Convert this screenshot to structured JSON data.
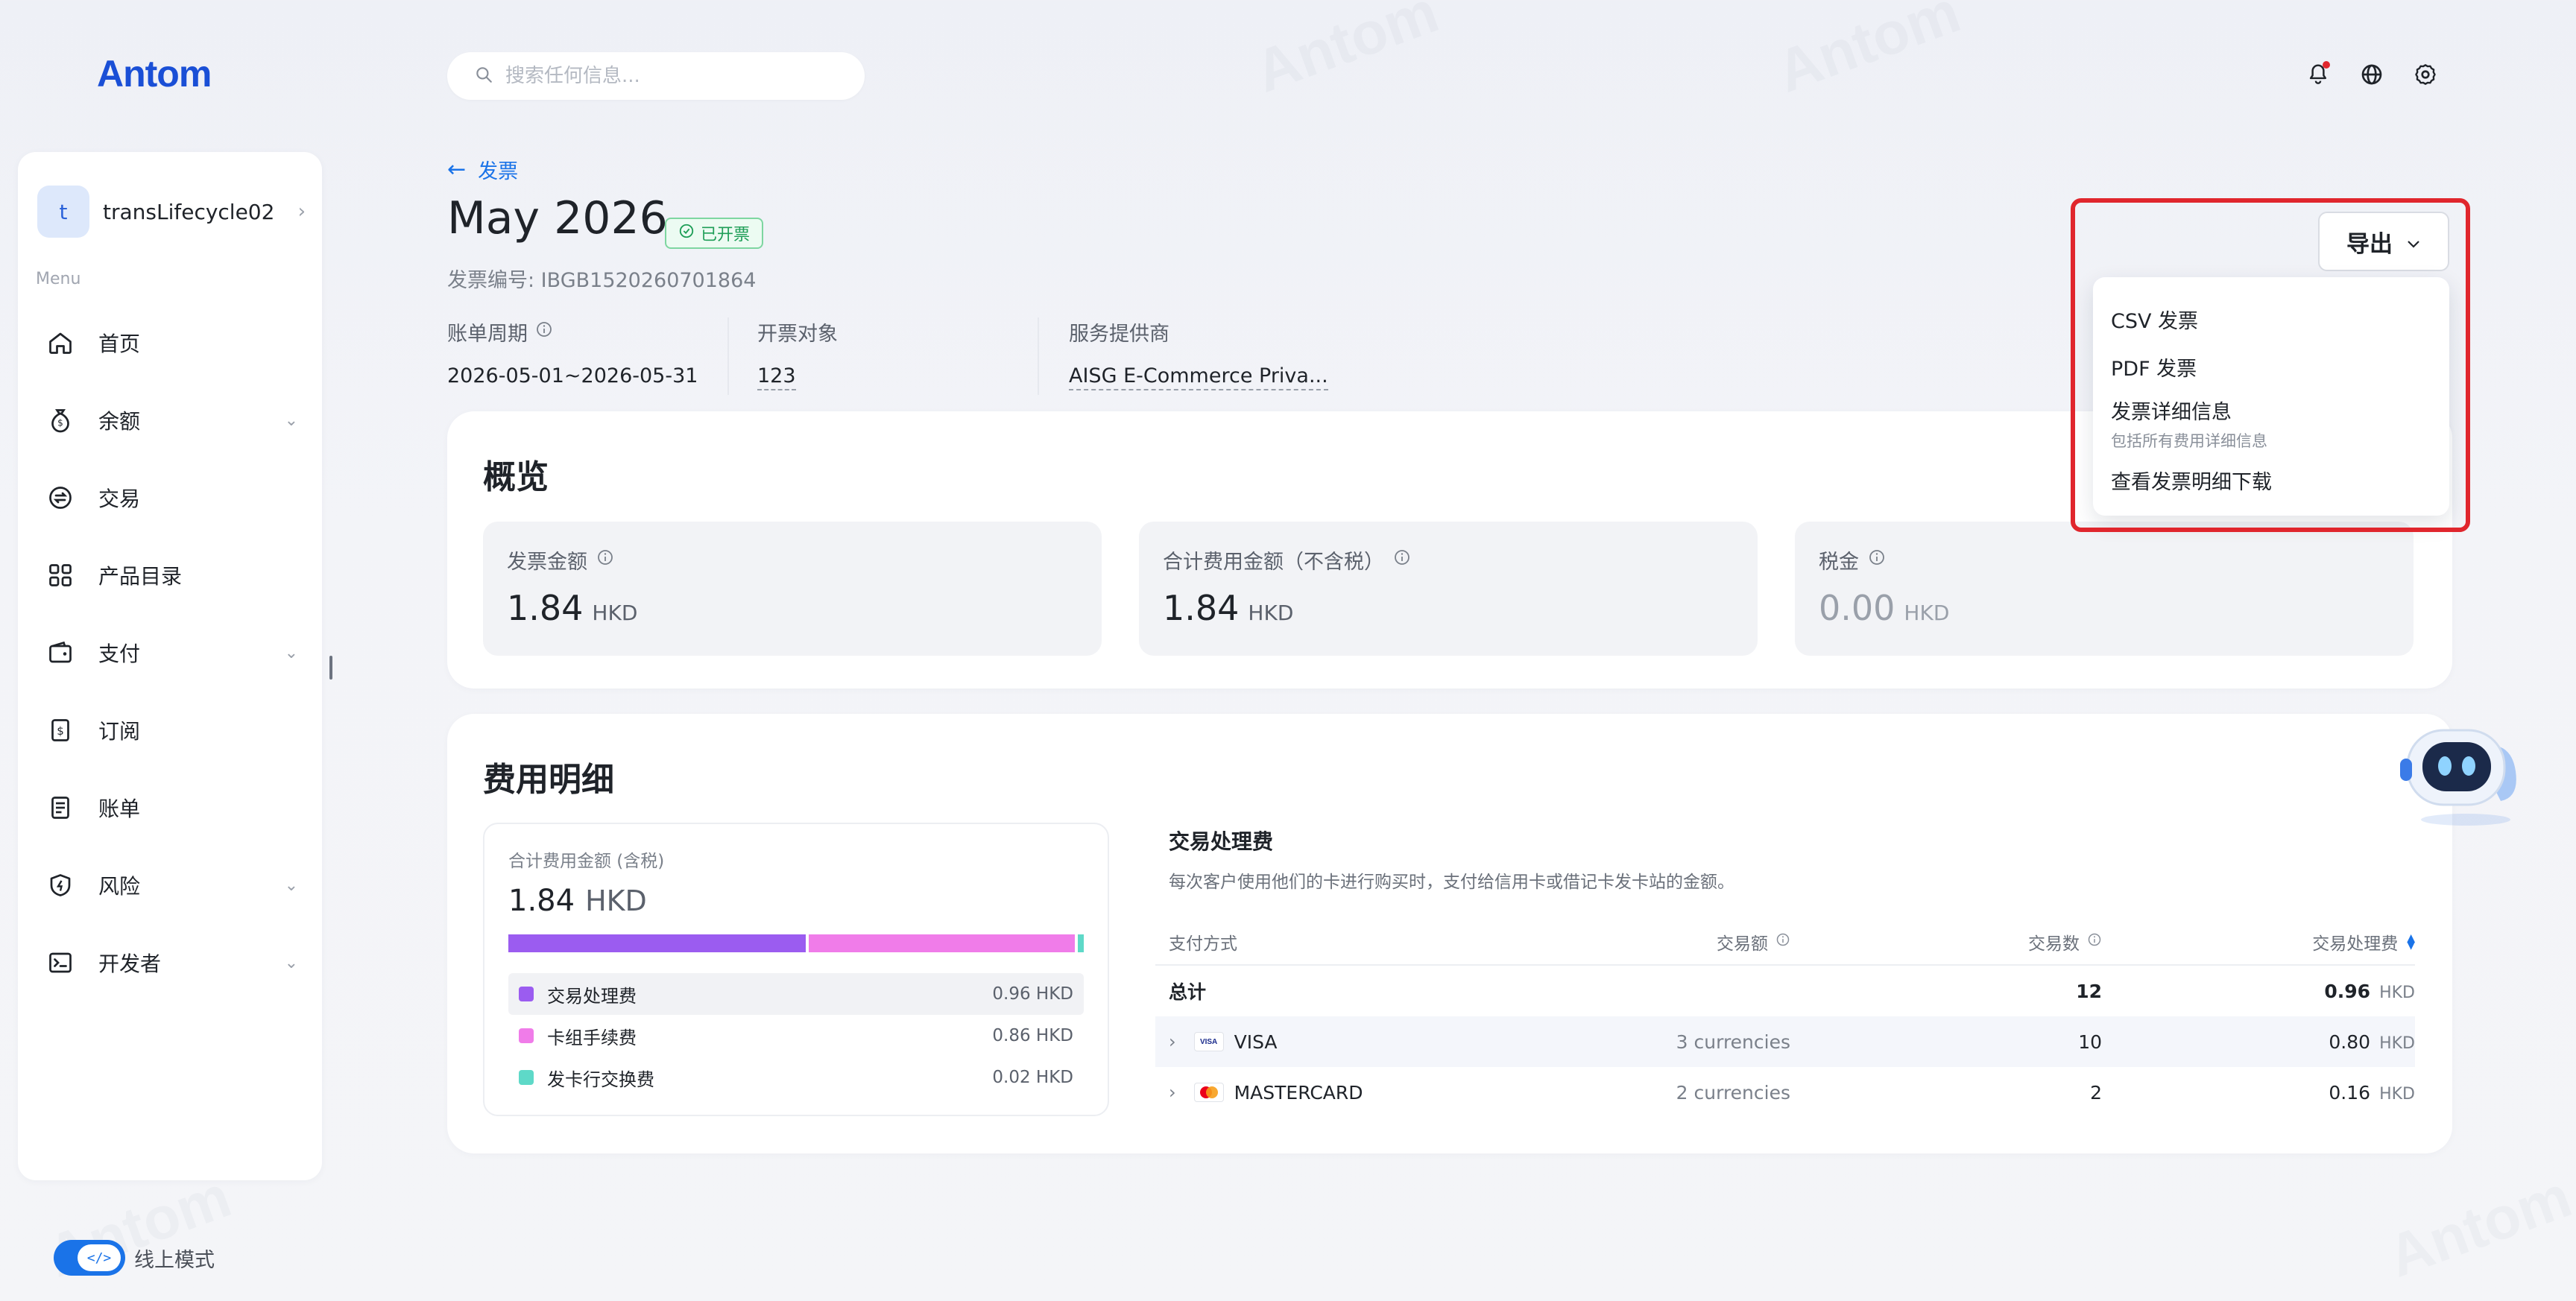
{
  "brand": {
    "logo_text": "Antom",
    "accent": "#1a73e8",
    "watermark": "Antom"
  },
  "search": {
    "placeholder": "搜索任何信息..."
  },
  "sidebar": {
    "account_initial": "t",
    "account_name": "transLifecycle02",
    "menu_label": "Menu",
    "items": [
      {
        "label": "首页",
        "icon": "home-icon",
        "expandable": false
      },
      {
        "label": "余额",
        "icon": "money-bag-icon",
        "expandable": true
      },
      {
        "label": "交易",
        "icon": "exchange-icon",
        "expandable": false
      },
      {
        "label": "产品目录",
        "icon": "grid-icon",
        "expandable": false
      },
      {
        "label": "支付",
        "icon": "wallet-icon",
        "expandable": true
      },
      {
        "label": "订阅",
        "icon": "subscription-icon",
        "expandable": false
      },
      {
        "label": "账单",
        "icon": "bill-icon",
        "expandable": false
      },
      {
        "label": "风险",
        "icon": "shield-icon",
        "expandable": true
      },
      {
        "label": "开发者",
        "icon": "terminal-icon",
        "expandable": true
      }
    ],
    "mode_label": "线上模式",
    "mode_toggle": "</>"
  },
  "header": {
    "back_label": "发票",
    "title": "May 2026",
    "status": "已开票",
    "invoice_no": "发票编号: IBGB1520260701864",
    "meta": [
      {
        "label": "账单周期",
        "value": "2026-05-01~2026-05-31"
      },
      {
        "label": "开票对象",
        "value": "123"
      },
      {
        "label": "服务提供商",
        "value": "AISG E-Commerce Priva..."
      }
    ]
  },
  "export": {
    "button_label": "导出",
    "options": [
      {
        "label": "CSV 发票"
      },
      {
        "label": "PDF 发票"
      },
      {
        "label": "发票详细信息",
        "sub": "包括所有费用详细信息"
      },
      {
        "label": "查看发票明细下载"
      }
    ]
  },
  "overview": {
    "title": "概览",
    "kpis": [
      {
        "label": "发票金额",
        "value": "1.84",
        "currency": "HKD"
      },
      {
        "label": "合计费用金额（不含税）",
        "value": "1.84",
        "currency": "HKD"
      },
      {
        "label": "税金",
        "value": "0.00",
        "currency": "HKD"
      }
    ]
  },
  "fees": {
    "title": "费用明细",
    "total_label": "合计费用金额 (含税)",
    "total_value": "1.84",
    "total_currency": "HKD",
    "breakdown": [
      {
        "label": "交易处理费",
        "value": "0.96 HKD",
        "amount": 0.96,
        "color": "#9b5cf0"
      },
      {
        "label": "卡组手续费",
        "value": "0.86 HKD",
        "amount": 0.86,
        "color": "#f07ce9"
      },
      {
        "label": "发卡行交换费",
        "value": "0.02 HKD",
        "amount": 0.02,
        "color": "#5ed9c8"
      }
    ],
    "tx_title": "交易处理费",
    "tx_desc": "每次客户使用他们的卡进行购买时，支付给信用卡或借记卡发卡站的金额。",
    "columns": [
      "支付方式",
      "交易额",
      "交易数",
      "交易处理费"
    ],
    "total_row": {
      "label": "总计",
      "count": "12",
      "fee": "0.96",
      "currency": "HKD"
    },
    "rows": [
      {
        "method": "VISA",
        "logo_text": "VISA",
        "amount": "3 currencies",
        "count": "10",
        "fee": "0.80",
        "currency": "HKD"
      },
      {
        "method": "MASTERCARD",
        "logo_text": "",
        "amount": "2 currencies",
        "count": "2",
        "fee": "0.16",
        "currency": "HKD"
      }
    ]
  }
}
